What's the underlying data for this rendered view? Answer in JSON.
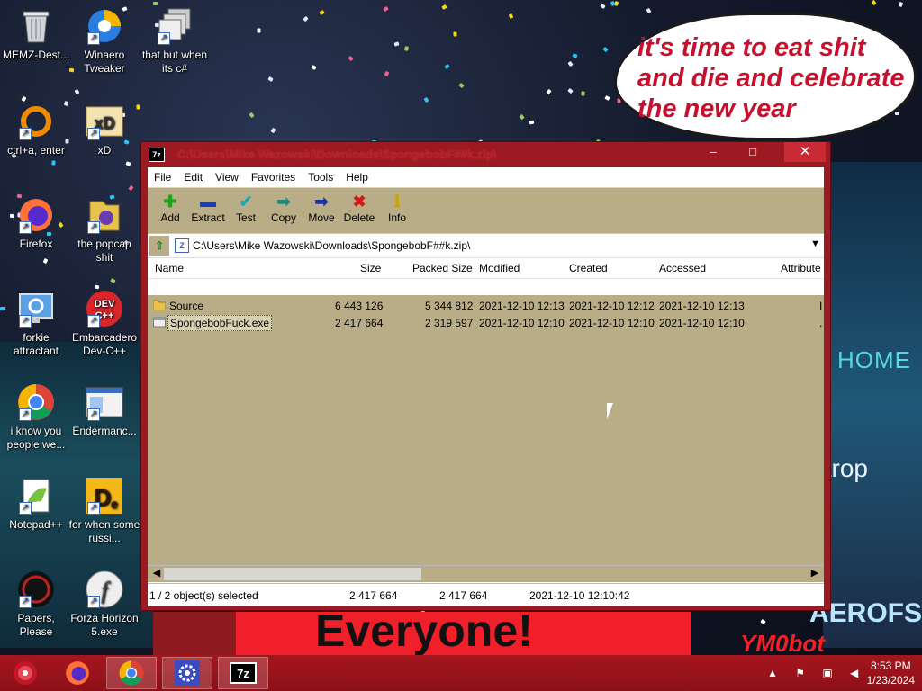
{
  "wallpaper": {
    "speech_text": "it's time to eat shit and die and celebrate the new year",
    "banner_text": "Everyone!",
    "signs": [
      "HOME",
      "trop",
      "AEROFS"
    ],
    "watermark": "YM0bot"
  },
  "desktop_icons": [
    {
      "label": "MEMZ-Dest...",
      "icon": "recycle-bin-icon"
    },
    {
      "label": "Winaero Tweaker",
      "icon": "winaero-icon"
    },
    {
      "label": "that but when its c#",
      "icon": "windows-stack-icon"
    },
    {
      "label": "ctrl+a, enter",
      "icon": "orange-ring-icon"
    },
    {
      "label": "xD",
      "icon": "hxd-icon"
    },
    {
      "label": "Firefox",
      "icon": "firefox-icon"
    },
    {
      "label": "the popcap shit",
      "icon": "popcap-folder-icon"
    },
    {
      "label": "forkie attractant",
      "icon": "monitor-gear-icon"
    },
    {
      "label": "Embarcadero Dev-C++",
      "icon": "devcpp-icon"
    },
    {
      "label": "i know you people we...",
      "icon": "chrome-icon"
    },
    {
      "label": "Endermanc...",
      "icon": "window-app-icon"
    },
    {
      "label": "Notepad++",
      "icon": "notepadpp-icon"
    },
    {
      "label": "for when some russi...",
      "icon": "de-icon"
    },
    {
      "label": "Papers, Please",
      "icon": "papers-please-icon"
    },
    {
      "label": "Forza Horizon 5.exe",
      "icon": "flash-icon"
    }
  ],
  "window": {
    "title": "C:\\Users\\Mike Wazowski\\Downloads\\SpongebobF##k.zip\\",
    "logo": "7z",
    "close": "✕",
    "menu": [
      "File",
      "Edit",
      "View",
      "Favorites",
      "Tools",
      "Help"
    ],
    "toolbar": [
      {
        "label": "Add",
        "icon": "add-icon",
        "glyph": "✚",
        "color": "#1aa51a"
      },
      {
        "label": "Extract",
        "icon": "extract-icon",
        "glyph": "▬",
        "color": "#1a3fb8"
      },
      {
        "label": "Test",
        "icon": "test-icon",
        "glyph": "✔",
        "color": "#16a7b8"
      },
      {
        "label": "Copy",
        "icon": "copy-icon",
        "glyph": "➡",
        "color": "#1b8a7a"
      },
      {
        "label": "Move",
        "icon": "move-icon",
        "glyph": "➡",
        "color": "#1a2fa0"
      },
      {
        "label": "Delete",
        "icon": "delete-icon",
        "glyph": "✖",
        "color": "#d21a1a"
      },
      {
        "label": "Info",
        "icon": "info-icon",
        "glyph": "ℹ",
        "color": "#c9a400"
      }
    ],
    "address": "C:\\Users\\Mike Wazowski\\Downloads\\SpongebobF##k.zip\\",
    "columns": [
      "Name",
      "Size",
      "Packed Size",
      "Modified",
      "Created",
      "Accessed",
      "Attribute"
    ],
    "rows": [
      {
        "name": "Source",
        "size": "6 443 126",
        "packed": "5 344 812",
        "modified": "2021-12-10 12:13",
        "created": "2021-12-10 12:12",
        "accessed": "2021-12-10 12:13",
        "attr": "I",
        "icon": "folder-icon",
        "selected": false
      },
      {
        "name": "SpongebobFuck.exe",
        "size": "2 417 664",
        "packed": "2 319 597",
        "modified": "2021-12-10 12:10",
        "created": "2021-12-10 12:10",
        "accessed": "2021-12-10 12:10",
        "attr": ".",
        "icon": "exe-icon",
        "selected": true
      }
    ],
    "status": {
      "selection": "1 / 2 object(s) selected",
      "size": "2 417 664",
      "packed": "2 417 664",
      "modified": "2021-12-10 12:10:42"
    }
  },
  "taskbar": {
    "apps": [
      "start-icon",
      "firefox-icon",
      "chrome-icon",
      "settings-icon",
      "7zip-icon"
    ],
    "time": "8:53 PM",
    "date": "1/23/2024"
  }
}
